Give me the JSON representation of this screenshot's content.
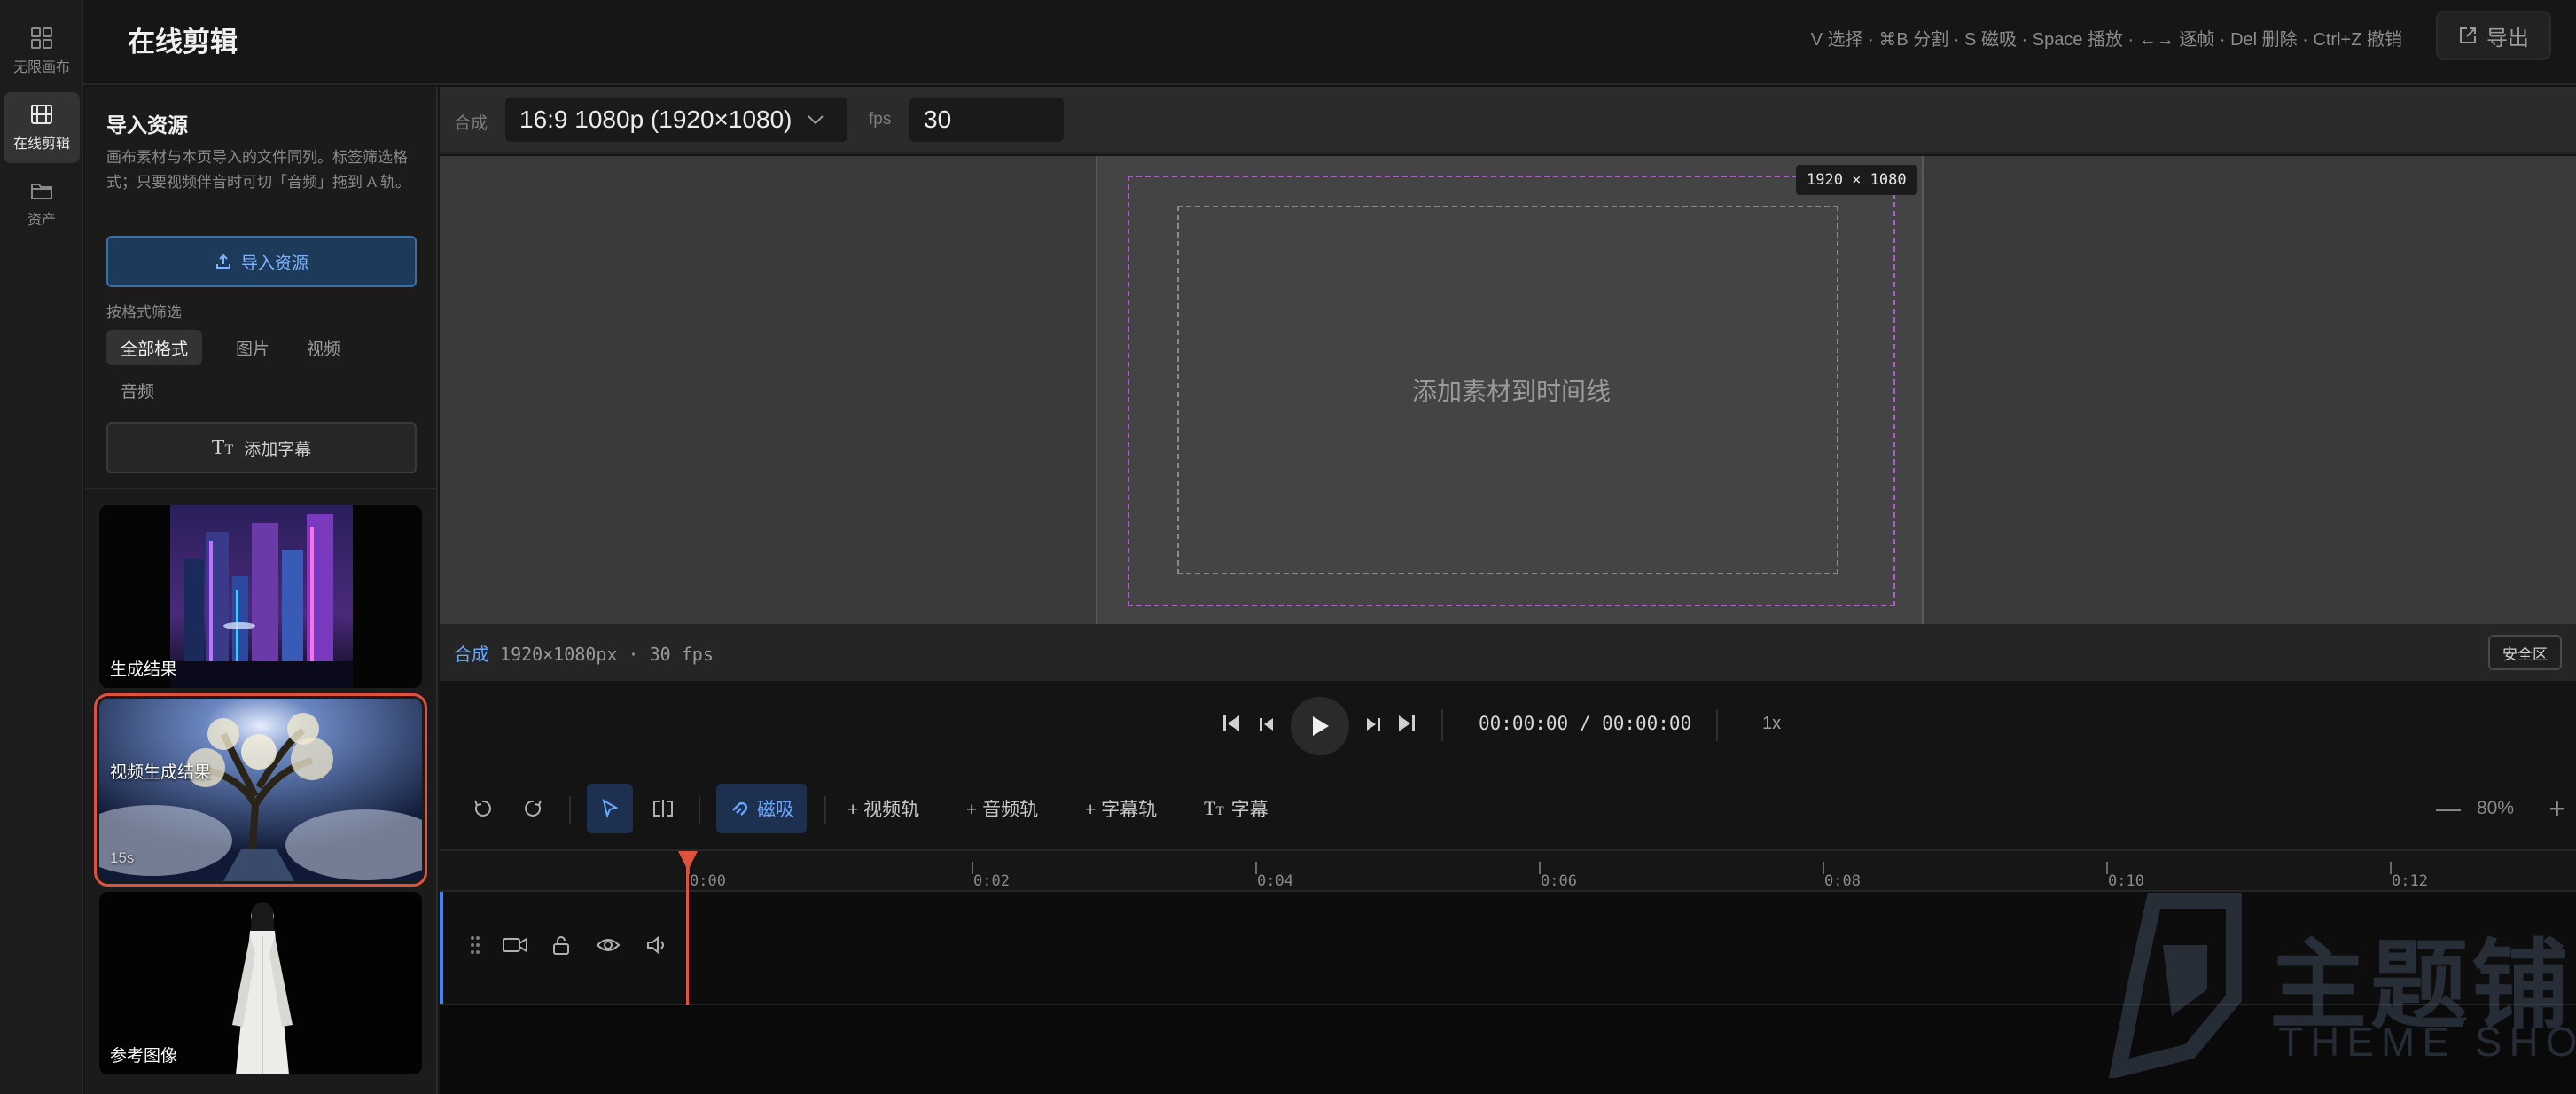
{
  "rail": {
    "items": [
      {
        "label": "无限画布",
        "icon": "grid-icon",
        "active": false
      },
      {
        "label": "在线剪辑",
        "icon": "film-icon",
        "active": true
      },
      {
        "label": "资产",
        "icon": "folder-icon",
        "active": false
      }
    ]
  },
  "header": {
    "title": "在线剪辑",
    "shortcuts": "V 选择 · ⌘B 分割 · S 磁吸 · Space 播放 · ←→ 逐帧 · Del 删除 · Ctrl+Z 撤销",
    "export_label": "导出"
  },
  "panel": {
    "title": "导入资源",
    "description": "画布素材与本页导入的文件同列。标签筛选格式；只要视频伴音时可切「音频」拖到 A 轨。",
    "import_label": "导入资源",
    "filter_title": "按格式筛选",
    "filters": [
      "全部格式",
      "图片",
      "视频",
      "音频"
    ],
    "active_filter": "全部格式",
    "add_subtitle_label": "添加字幕",
    "assets": [
      {
        "label": "生成结果",
        "sub": "",
        "thumb": "neon-city-image"
      },
      {
        "label": "视频生成结果",
        "sub": "15s",
        "thumb": "moonlit-tree-video",
        "selected": true
      },
      {
        "label": "参考图像",
        "sub": "",
        "thumb": "white-robed-figure-image"
      }
    ]
  },
  "composition": {
    "label": "合成",
    "ratio": "16:9 1080p (1920×1080)",
    "fps_label": "fps",
    "fps_value": "30",
    "resolution_badge": "1920 × 1080",
    "empty_hint": "添加素材到时间线"
  },
  "status": {
    "prefix": "合成",
    "text": "1920×1080px · 30 fps",
    "safe_area_label": "安全区"
  },
  "playback": {
    "timecode": "00:00:00 / 00:00:00",
    "speed": "1x"
  },
  "timeline": {
    "magnet_label": "磁吸",
    "add_video_track": "+ 视频轨",
    "add_audio_track": "+ 音频轨",
    "add_subtitle_track": "+ 字幕轨",
    "subtitle_label": "字幕",
    "zoom_minus": "—",
    "zoom_level": "80%",
    "zoom_plus": "+",
    "ruler_labels": [
      "0:00",
      "0:02",
      "0:04",
      "0:06",
      "0:08",
      "0:10",
      "0:12"
    ]
  },
  "watermark": {
    "text": "主题铺",
    "sub": "THEME SHOP"
  },
  "colors": {
    "accent": "#3a86ff",
    "playhead": "#e0523b",
    "safe_outer": "#b35bd6"
  }
}
